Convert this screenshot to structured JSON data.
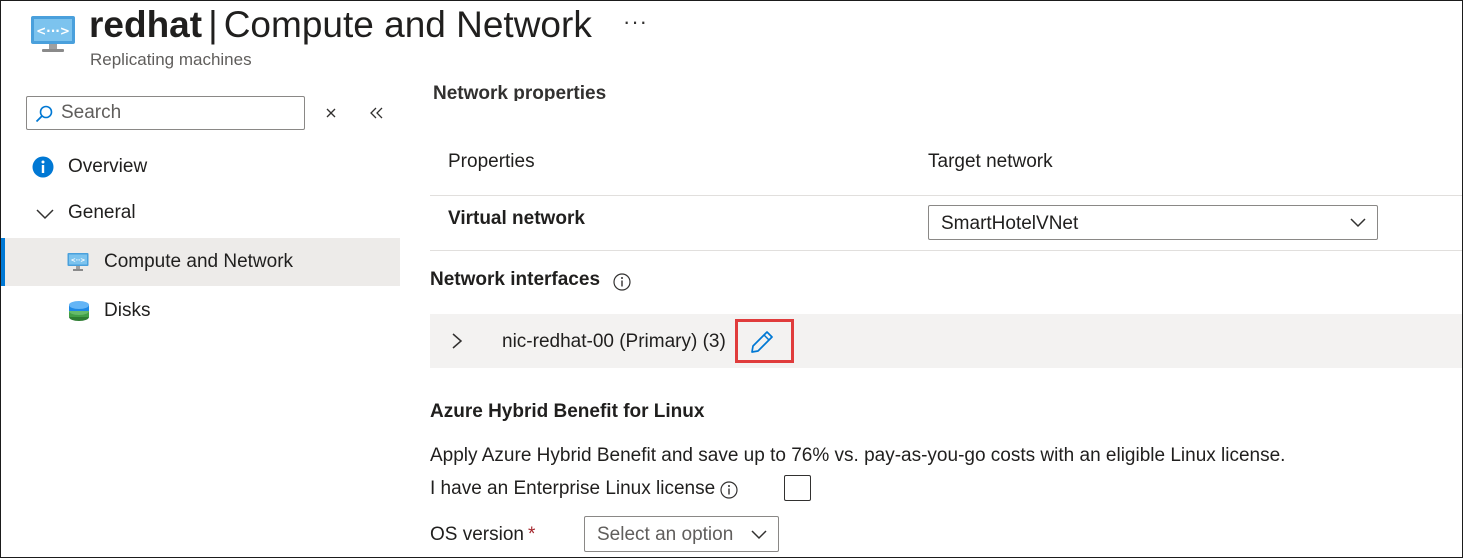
{
  "header": {
    "resource_name": "redhat",
    "separator": "|",
    "page_name": "Compute and Network",
    "more_label": "···",
    "subtitle": "Replicating machines"
  },
  "sidebar": {
    "search": {
      "placeholder": "Search",
      "value": ""
    },
    "clear_label": "clear",
    "collapse_label": "collapse",
    "items": [
      {
        "label": "Overview",
        "icon": "info-icon"
      },
      {
        "label": "General",
        "icon": "chevron-down-icon"
      },
      {
        "label": "Compute and Network",
        "icon": "virtual-machine-icon",
        "selected": true
      },
      {
        "label": "Disks",
        "icon": "disks-icon"
      }
    ]
  },
  "main": {
    "partial_heading": "Network properties",
    "table": {
      "col_properties": "Properties",
      "col_target": "Target network",
      "row_label": "Virtual network",
      "row_value": "SmartHotelVNet"
    },
    "network_interfaces": {
      "heading": "Network interfaces",
      "nic_label": "nic-redhat-00 (Primary) (3)"
    },
    "hybrid": {
      "heading": "Azure Hybrid Benefit for Linux",
      "description": "Apply Azure Hybrid Benefit and save up to 76% vs. pay-as-you-go costs with an eligible Linux license.",
      "license_label": "I have an Enterprise Linux license",
      "license_checked": false,
      "os_label": "OS version",
      "os_required": "*",
      "os_placeholder": "Select an option"
    }
  },
  "colors": {
    "accent": "#0078d4",
    "highlight_box": "#e03c3c",
    "selected_bg": "#edebe9",
    "row_bg": "#f3f2f1"
  }
}
